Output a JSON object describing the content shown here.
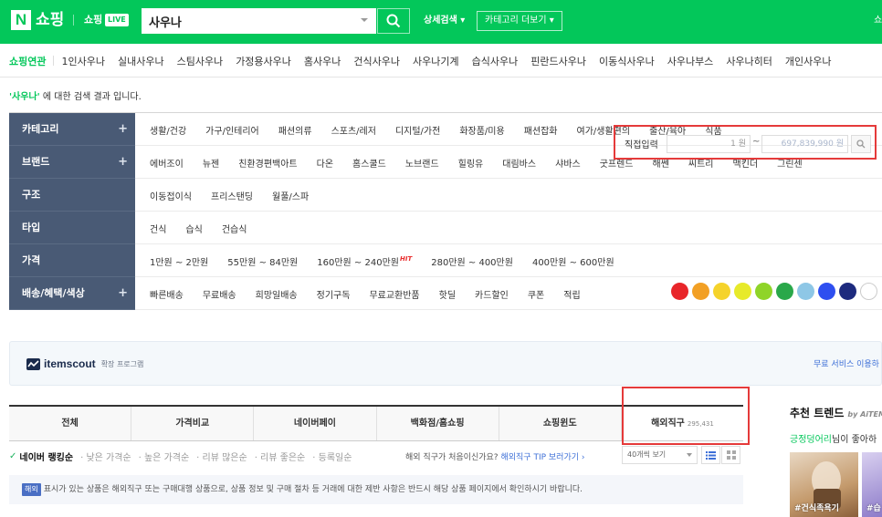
{
  "header": {
    "logo": "N",
    "logo_text": "쇼핑",
    "live_label": "쇼핑",
    "live_badge": "LIVE",
    "search_value": "사우나",
    "detail_search": "상세검색",
    "category_more": "카테고리 더보기",
    "right_cut": "쇼"
  },
  "related": {
    "title": "쇼핑연관",
    "items": [
      "1인사우나",
      "실내사우나",
      "스팀사우나",
      "가정용사우나",
      "홈사우나",
      "건식사우나",
      "사우나기계",
      "습식사우나",
      "핀란드사우나",
      "이동식사우나",
      "사우나부스",
      "사우나히터",
      "개인사우나"
    ]
  },
  "result_note": {
    "query": "'사우나'",
    "suffix": " 에 대한 검색 결과 입니다."
  },
  "filters": [
    {
      "label": "카테고리",
      "plus": "+",
      "items": [
        "생활/건강",
        "가구/인테리어",
        "패션의류",
        "스포츠/레저",
        "디지털/가전",
        "화장품/미용",
        "패션잡화",
        "여가/생활편의",
        "출산/육아",
        "식품"
      ]
    },
    {
      "label": "브랜드",
      "plus": "+",
      "items": [
        "에버조이",
        "뉴젠",
        "친환경편백아트",
        "다온",
        "홈스쿨드",
        "노브랜드",
        "힐링유",
        "대림바스",
        "샤바스",
        "굿프렌드",
        "해쎈",
        "씨트리",
        "맥킨더",
        "그린센"
      ]
    },
    {
      "label": "구조",
      "plus": "",
      "items": [
        "이동접이식",
        "프리스탠딩",
        "월풀/스파"
      ]
    },
    {
      "label": "타입",
      "plus": "",
      "items": [
        "건식",
        "습식",
        "건습식"
      ]
    },
    {
      "label": "가격",
      "plus": "",
      "items": [
        "1만원 ~ 2만원",
        "55만원 ~ 84만원",
        "160만원 ~ 240만원",
        "280만원 ~ 400만원",
        "400만원 ~ 600만원"
      ],
      "hit_text": "HIT"
    },
    {
      "label": "배송/혜택/색상",
      "plus": "+",
      "items": [
        "빠른배송",
        "무료배송",
        "희망일배송",
        "정기구독",
        "무료교환반품",
        "핫딜",
        "카드할인",
        "쿠폰",
        "적립"
      ]
    }
  ],
  "price_input": {
    "label": "직접입력",
    "min": "1 원",
    "tilde": "~",
    "max": "697,839,990 원"
  },
  "colors": [
    "#e8262a",
    "#f2a025",
    "#f5d32b",
    "#e7ea2a",
    "#8fd428",
    "#2aa84a",
    "#8ec7e6",
    "#2e4ff0",
    "#1d2a7e",
    "#ffffff"
  ],
  "itemscout": {
    "name": "itemscout",
    "sub": "확장 프로그램",
    "free": "무료 서비스 이용하"
  },
  "tabs": [
    {
      "label": "전체"
    },
    {
      "label": "가격비교"
    },
    {
      "label": "네이버페이"
    },
    {
      "label": "백화점/홈쇼핑"
    },
    {
      "label": "쇼핑윈도"
    },
    {
      "label": "해외직구",
      "count": "295,431"
    }
  ],
  "sort": {
    "active": "네이버 랭킹순",
    "options": [
      "낮은 가격순",
      "높은 가격순",
      "리뷰 많은순",
      "리뷰 좋은순",
      "등록일순"
    ]
  },
  "tip": {
    "question": "해외 직구가 처음이신가요?",
    "link": "해외직구 TIP 보러가기 ›"
  },
  "view": {
    "per_page": "40개씩 보기"
  },
  "notice": {
    "badge": "해외",
    "text": "표시가 있는 상품은 해외직구 또는 구매대행 상품으로, 상품 정보 및 구매 절차 등 거래에 대한 제반 사항은 반드시 해당 상품 페이지에서 확인하시기 바랍니다."
  },
  "trend": {
    "title": "추천 트렌드",
    "by": "by AiTEMS",
    "user": "긍정덩어리",
    "user_suffix": "님이 좋아하",
    "tile1": "#건식족욕기",
    "tile2": "#습"
  }
}
